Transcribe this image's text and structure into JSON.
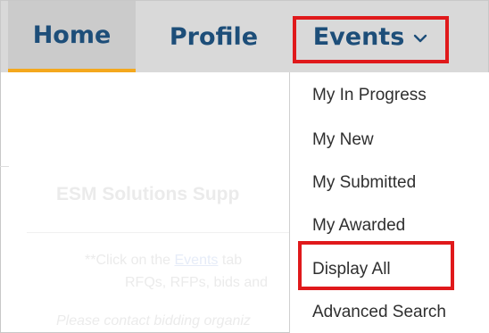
{
  "nav": {
    "home": "Home",
    "profile": "Profile",
    "events": "Events"
  },
  "events_menu": [
    "My In Progress",
    "My New",
    "My Submitted",
    "My Awarded",
    "Display All",
    "Advanced Search"
  ],
  "background": {
    "title": "ESM Solutions Supp",
    "click_prefix": "**Click on the ",
    "events_link": "Events",
    "click_suffix": " tab",
    "rfq_line": "RFQs, RFPs, bids and",
    "contact_line": "Please contact bidding organiz"
  },
  "colors": {
    "nav_text": "#1d4e79",
    "nav_bg": "#d9d9d9",
    "active_underline": "#f4a81d",
    "highlight_box": "#e0191b"
  }
}
